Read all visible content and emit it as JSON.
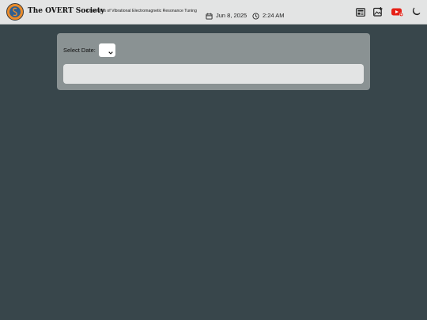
{
  "header": {
    "title": "The OVERT Society",
    "subtitle": "Observers of Vibrational Electromagnetic Resonance Tuning",
    "date": "Jun 8, 2025",
    "time": "2:24 AM",
    "icons": [
      "calendar-icon",
      "clock-icon",
      "newspaper-icon",
      "image-add-icon",
      "youtube-icon",
      "moon-icon"
    ],
    "colors": {
      "logo_outer": "#e98b2b",
      "logo_inner": "#2f5f8f",
      "youtube": "#e62117"
    }
  },
  "main": {
    "select_date_label": "Select Date:",
    "date_select_value": ""
  }
}
